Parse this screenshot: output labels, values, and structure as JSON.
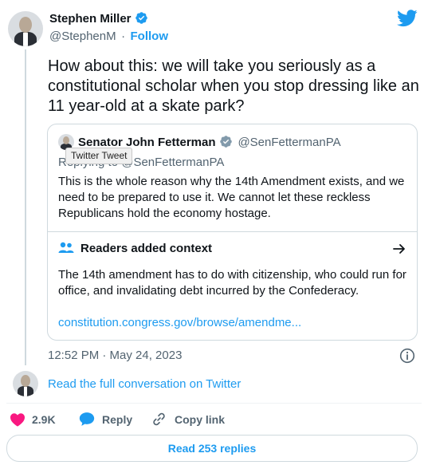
{
  "author": {
    "name": "Stephen Miller",
    "handle": "@StephenM",
    "separator": "·",
    "follow_label": "Follow"
  },
  "tweet": {
    "text": "How about this: we will take you seriously as a constitutional scholar when you stop dressing like an 11 year-old at a skate park?",
    "timestamp": "12:52 PM · May 24, 2023"
  },
  "quoted": {
    "name": "Senator John Fetterman",
    "handle": "@SenFettermanPA",
    "replying_to": "Replying to @SenFettermanPA",
    "tooltip": "Twitter Tweet",
    "text": "This is the whole reason why the 14th Amendment exists, and we need to be prepared to use it. We cannot let these reckless Republicans hold the economy hostage."
  },
  "context": {
    "title": "Readers added context",
    "body": "The 14th amendment has to do with citizenship, who could run for office, and invalidating debt incurred by the Confederacy.",
    "link": "constitution.congress.gov/browse/amendme..."
  },
  "conversation_link": "Read the full conversation on Twitter",
  "actions": {
    "likes": "2.9K",
    "reply_label": "Reply",
    "copy_link_label": "Copy link"
  },
  "read_replies_label": "Read 253 replies",
  "colors": {
    "brand_blue": "#1d9bf0",
    "like_pink": "#f91880",
    "text_secondary": "#536471",
    "border": "#cfd9de"
  }
}
